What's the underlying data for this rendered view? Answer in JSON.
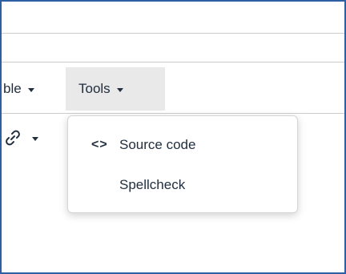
{
  "menubar": {
    "items": [
      {
        "label": "ble",
        "icon": "chevron-down-icon"
      },
      {
        "label": "Tools",
        "icon": "chevron-down-icon",
        "active": true
      }
    ]
  },
  "toolbar": {
    "link_icon": "link-icon",
    "link_chevron": "chevron-down-icon"
  },
  "dropdown": {
    "items": [
      {
        "label": "Source code",
        "icon": "code-icon",
        "icon_glyph": "<>"
      },
      {
        "label": "Spellcheck"
      }
    ]
  },
  "colors": {
    "frame_border": "#2f5fa3",
    "active_menu_bg": "#e9e9e9",
    "text": "#222f3e",
    "divider": "#cccccc"
  }
}
